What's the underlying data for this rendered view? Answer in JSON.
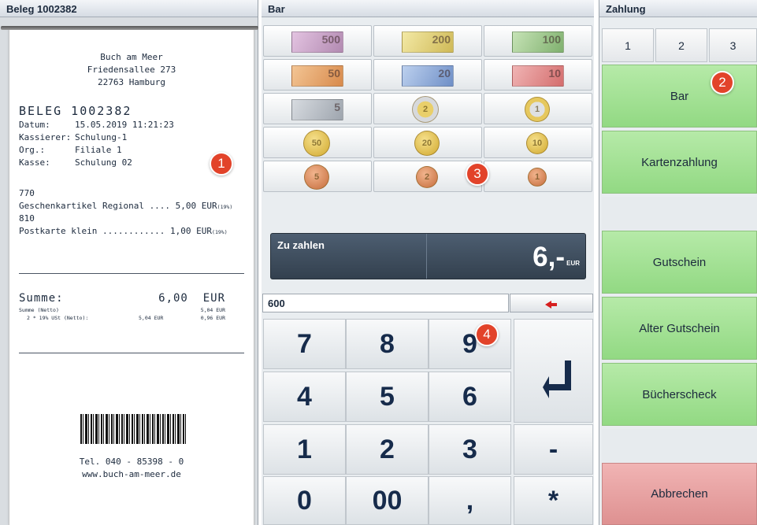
{
  "receipt_panel": {
    "title": "Beleg 1002382",
    "shop": [
      "Buch am Meer",
      "Friedensallee 273",
      "22763 Hamburg"
    ],
    "heading": "BELEG  1002382",
    "meta": [
      {
        "key": "Datum:",
        "value": "15.05.2019 11:21:23"
      },
      {
        "key": "Kassierer:",
        "value": "Schulung-1"
      },
      {
        "key": "Org.:",
        "value": "Filiale 1"
      },
      {
        "key": "Kasse:",
        "value": "Schulung 02"
      }
    ],
    "items": [
      {
        "code": "770",
        "line": "Geschenkartikel Regional .... 5,00 EUR",
        "tax": "(19%)"
      },
      {
        "code": "810",
        "line": "Postkarte klein ............ 1,00 EUR",
        "tax": "(19%)"
      }
    ],
    "total_label": "Summe:",
    "total_value": "6,00  EUR",
    "net_label": "Summe (Netto)",
    "net_value": "5,04 EUR",
    "tax_label": "2 * 19% USt (Netto):",
    "tax_base": "5,04 EUR",
    "tax_value": "0,96 EUR",
    "phone": "Tel. 040 - 85398 - 0",
    "web": "www.buch-am-meer.de"
  },
  "cash_panel": {
    "title": "Bar",
    "notes": [
      {
        "value": "500",
        "color": "#c9a3c8"
      },
      {
        "value": "200",
        "color": "#e7d680"
      },
      {
        "value": "100",
        "color": "#9cc98b"
      },
      {
        "value": "50",
        "color": "#e8a86b"
      },
      {
        "value": "20",
        "color": "#8fa9d6"
      },
      {
        "value": "10",
        "color": "#e68f8f"
      },
      {
        "value": "5",
        "color": "#b7bcc4"
      }
    ],
    "coins": [
      {
        "value": "2",
        "kind": "bimetal"
      },
      {
        "value": "1",
        "kind": "bimetal"
      },
      {
        "value": "50",
        "kind": "gold"
      },
      {
        "value": "20",
        "kind": "gold"
      },
      {
        "value": "10",
        "kind": "gold"
      },
      {
        "value": "5",
        "kind": "copper"
      },
      {
        "value": "2",
        "kind": "copper"
      },
      {
        "value": "1",
        "kind": "copper"
      }
    ],
    "due_label": "Zu zahlen",
    "due_amount": "6,-",
    "due_currency": "EUR",
    "input_value": "600",
    "keys": [
      "7",
      "8",
      "9",
      "4",
      "5",
      "6",
      "1",
      "2",
      "3",
      "0",
      "00",
      ",",
      "-",
      "*"
    ]
  },
  "payment_panel": {
    "title": "Zahlung",
    "tabs": [
      "1",
      "2",
      "3"
    ],
    "buttons": [
      {
        "label": "Bar",
        "color": "#a4e294"
      },
      {
        "label": "Kartenzahlung",
        "color": "#a4e294"
      },
      {
        "label": "Gutschein",
        "color": "#a4e294"
      },
      {
        "label": "Alter Gutschein",
        "color": "#a4e294"
      },
      {
        "label": "Bücherscheck",
        "color": "#a4e294"
      },
      {
        "label": "Abbrechen",
        "color": "#e39a9a"
      }
    ]
  },
  "badges": [
    "1",
    "2",
    "3",
    "4"
  ]
}
